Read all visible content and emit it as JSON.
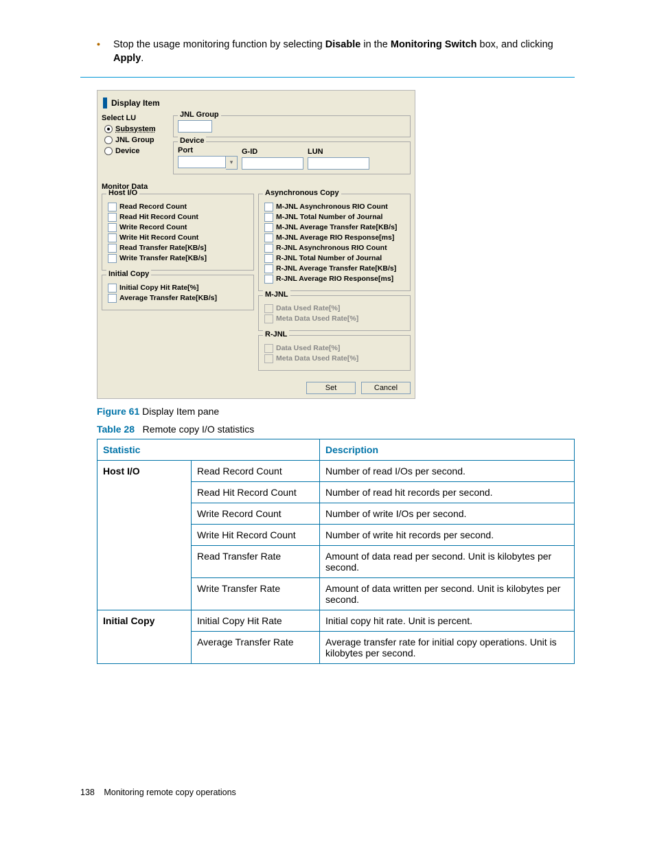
{
  "bullet": {
    "pre": "Stop the usage monitoring function by selecting ",
    "b1": "Disable",
    "mid1": " in the ",
    "b2": "Monitoring Switch",
    "mid2": " box, and clicking ",
    "b3": "Apply",
    "end": "."
  },
  "pane": {
    "title": "Display Item",
    "select_lu_title": "Select LU",
    "radios": {
      "subsystem": "Subsystem",
      "jnl_group": "JNL Group",
      "device": "Device"
    },
    "jnl_group_legend": "JNL Group",
    "device_legend": "Device",
    "device_cols": {
      "port": "Port",
      "gid": "G-ID",
      "lun": "LUN"
    },
    "monitor_data": "Monitor Data",
    "host_io_legend": "Host I/O",
    "host_io": [
      "Read Record Count",
      "Read Hit Record Count",
      "Write Record Count",
      "Write Hit Record Count",
      "Read Transfer Rate[KB/s]",
      "Write Transfer Rate[KB/s]"
    ],
    "async_legend": "Asynchronous Copy",
    "async": [
      "M-JNL Asynchronous RIO Count",
      "M-JNL Total Number of Journal",
      "M-JNL Average Transfer Rate[KB/s]",
      "M-JNL Average RIO Response[ms]",
      "R-JNL Asynchronous RIO Count",
      "R-JNL Total Number of Journal",
      "R-JNL Average Transfer Rate[KB/s]",
      "R-JNL Average RIO Response[ms]"
    ],
    "initial_copy_legend": "Initial Copy",
    "initial_copy": [
      "Initial Copy Hit Rate[%]",
      "Average Transfer Rate[KB/s]"
    ],
    "mjnl_legend": "M-JNL",
    "mjnl": [
      "Data Used Rate[%]",
      "Meta Data Used Rate[%]"
    ],
    "rjnl_legend": "R-JNL",
    "rjnl": [
      "Data Used Rate[%]",
      "Meta Data Used Rate[%]"
    ],
    "buttons": {
      "set": "Set",
      "cancel": "Cancel"
    }
  },
  "figure": {
    "num": "Figure 61",
    "caption": "Display Item pane"
  },
  "table_caption": {
    "num": "Table 28",
    "caption": "Remote copy I/O statistics"
  },
  "table": {
    "h_stat": "Statistic",
    "h_desc": "Description",
    "rows": {
      "g1": "Host I/O",
      "r1a": "Read Record Count",
      "r1b": "Number of read I/Os per second.",
      "r2a": "Read Hit Record Count",
      "r2b": "Number of read hit records per second.",
      "r3a": "Write Record Count",
      "r3b": "Number of write I/Os per second.",
      "r4a": "Write Hit Record Count",
      "r4b": "Number of write hit records per second.",
      "r5a": "Read Transfer Rate",
      "r5b": "Amount of data read per second. Unit is kilobytes per second.",
      "r6a": "Write Transfer Rate",
      "r6b": "Amount of data written per second. Unit is kilobytes per second.",
      "g2": "Initial Copy",
      "r7a": "Initial Copy Hit Rate",
      "r7b": "Initial copy hit rate. Unit is percent.",
      "r8a": "Average Transfer Rate",
      "r8b": "Average transfer rate for initial copy operations. Unit is kilobytes per second."
    }
  },
  "footer": {
    "pagenum": "138",
    "pagetitle": "Monitoring remote copy operations"
  }
}
